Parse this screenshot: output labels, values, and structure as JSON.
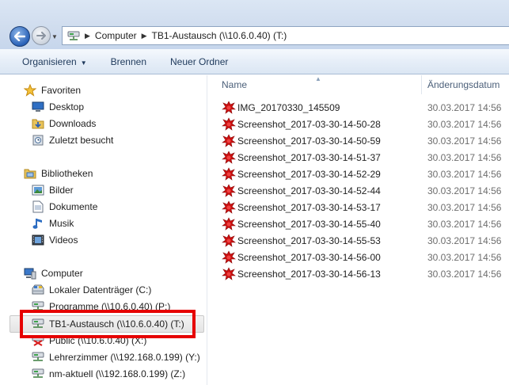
{
  "address": {
    "crumbs": [
      "Computer",
      "TB1-Austausch (\\\\10.6.0.40) (T:)"
    ]
  },
  "toolbar": {
    "organize": "Organisieren",
    "burn": "Brennen",
    "new_folder": "Neuer Ordner"
  },
  "nav": {
    "favorites": {
      "label": "Favoriten",
      "items": [
        "Desktop",
        "Downloads",
        "Zuletzt besucht"
      ]
    },
    "libraries": {
      "label": "Bibliotheken",
      "items": [
        "Bilder",
        "Dokumente",
        "Musik",
        "Videos"
      ]
    },
    "computer": {
      "label": "Computer",
      "items": [
        "Lokaler Datenträger (C:)",
        "Programme (\\\\10.6.0.40) (P:)",
        "TB1-Austausch (\\\\10.6.0.40) (T:)",
        "Public (\\\\10.6.0.40) (X:)",
        "Lehrerzimmer (\\\\192.168.0.199) (Y:)",
        "nm-aktuell (\\\\192.168.0.199) (Z:)"
      ]
    }
  },
  "files": {
    "col_name": "Name",
    "col_date": "Änderungsdatum",
    "rows": [
      {
        "name": "IMG_20170330_145509",
        "date": "30.03.2017 14:56"
      },
      {
        "name": "Screenshot_2017-03-30-14-50-28",
        "date": "30.03.2017 14:56"
      },
      {
        "name": "Screenshot_2017-03-30-14-50-59",
        "date": "30.03.2017 14:56"
      },
      {
        "name": "Screenshot_2017-03-30-14-51-37",
        "date": "30.03.2017 14:56"
      },
      {
        "name": "Screenshot_2017-03-30-14-52-29",
        "date": "30.03.2017 14:56"
      },
      {
        "name": "Screenshot_2017-03-30-14-52-44",
        "date": "30.03.2017 14:56"
      },
      {
        "name": "Screenshot_2017-03-30-14-53-17",
        "date": "30.03.2017 14:56"
      },
      {
        "name": "Screenshot_2017-03-30-14-55-40",
        "date": "30.03.2017 14:56"
      },
      {
        "name": "Screenshot_2017-03-30-14-55-53",
        "date": "30.03.2017 14:56"
      },
      {
        "name": "Screenshot_2017-03-30-14-56-00",
        "date": "30.03.2017 14:56"
      },
      {
        "name": "Screenshot_2017-03-30-14-56-13",
        "date": "30.03.2017 14:56"
      }
    ]
  },
  "colors": {
    "highlight_box": "#e60000",
    "toolbar_text": "#1e395b",
    "file_icon": "#cc1010"
  }
}
